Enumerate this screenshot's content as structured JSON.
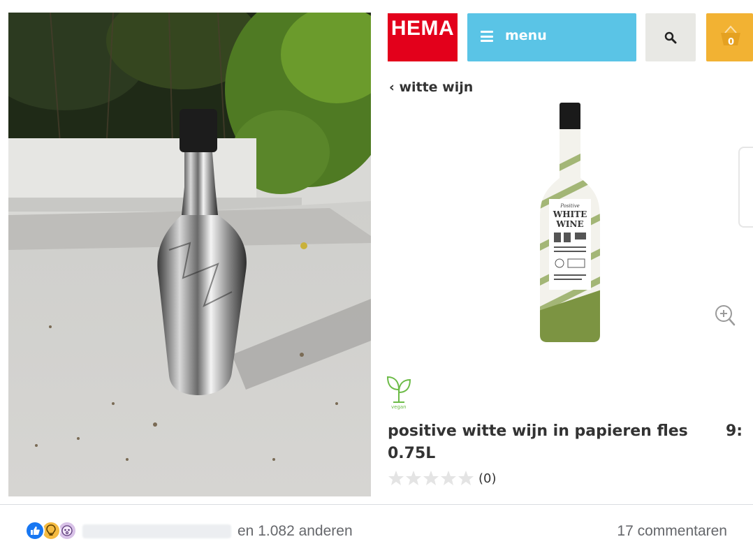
{
  "photo": {
    "alt_icon": "foil-wrapped-bottle-photo"
  },
  "shop": {
    "logo_text": "HEMA",
    "menu_label": "menu",
    "cart_count": "0",
    "back_link": "‹ witte wijn",
    "product_title": "positive witte wijn in papieren fles 0.75L",
    "price": "9:",
    "rating_count": "(0)",
    "rating_value": 0,
    "rating_max": 5,
    "vegan_label": "vegan",
    "label_text": {
      "line1": "Positive",
      "line2": "WHITE",
      "line3": "WINE"
    }
  },
  "footer": {
    "others": "en 1.082 anderen",
    "comments": "17 commentaren"
  },
  "colors": {
    "hema_red": "#e3001b",
    "menu_blue": "#5ac4e6",
    "cart_yellow": "#f2b233",
    "vegan_green": "#6cbb47"
  }
}
